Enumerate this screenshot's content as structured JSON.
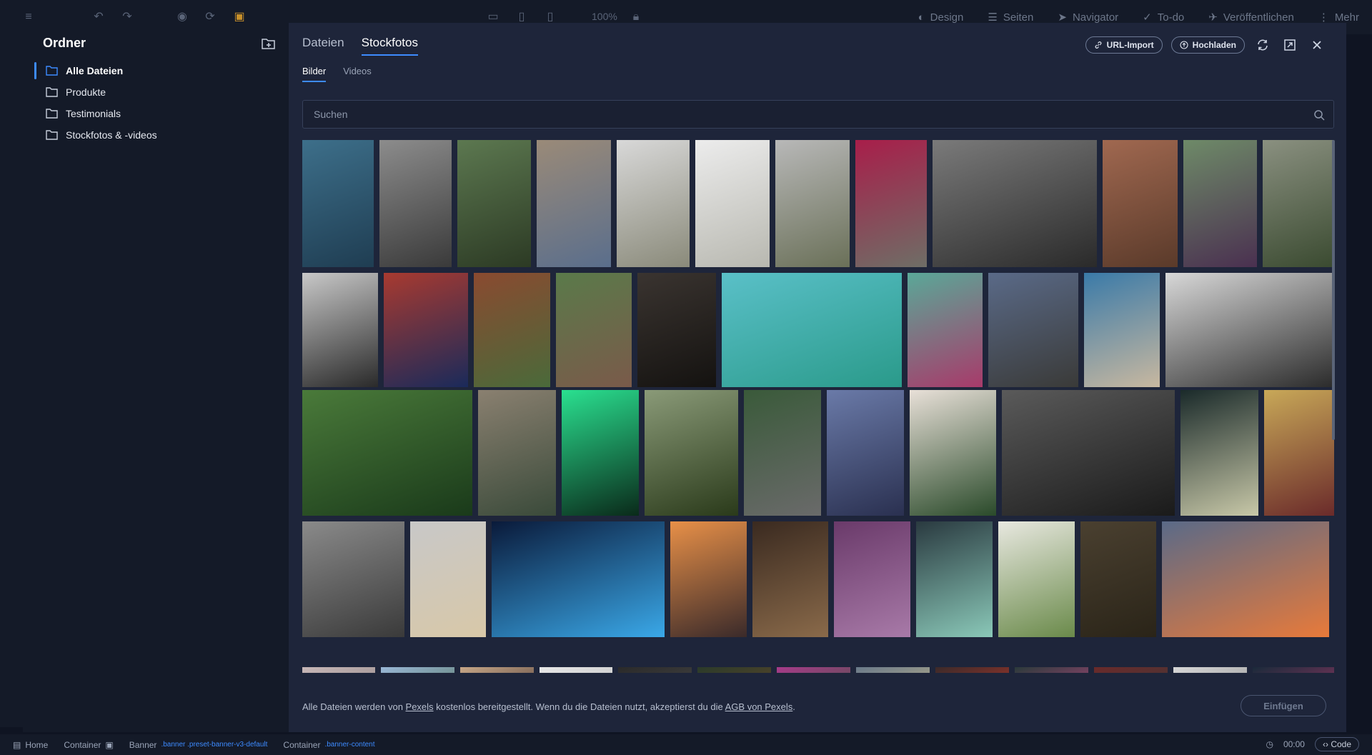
{
  "topbar": {
    "zoom": "100%",
    "items": [
      {
        "icon": "palette-icon",
        "label": "Design"
      },
      {
        "icon": "list-icon",
        "label": "Seiten"
      },
      {
        "icon": "navigator-icon",
        "label": "Navigator"
      },
      {
        "icon": "check-circle-icon",
        "label": "To-do"
      },
      {
        "icon": "rocket-icon",
        "label": "Veröffentlichen"
      },
      {
        "icon": "more-vertical-icon",
        "label": "Mehr"
      }
    ]
  },
  "folders": {
    "title": "Ordner",
    "items": [
      {
        "label": "Alle Dateien",
        "active": true
      },
      {
        "label": "Produkte",
        "active": false
      },
      {
        "label": "Testimonials",
        "active": false
      },
      {
        "label": "Stockfotos & -videos",
        "active": false
      }
    ]
  },
  "main_tabs": [
    {
      "label": "Dateien",
      "active": false
    },
    {
      "label": "Stockfotos",
      "active": true
    }
  ],
  "sub_tabs": [
    {
      "label": "Bilder",
      "active": true
    },
    {
      "label": "Videos",
      "active": false
    }
  ],
  "actions": {
    "url_import": "URL-Import",
    "upload": "Hochladen"
  },
  "search": {
    "placeholder": "Suchen",
    "value": ""
  },
  "footer": {
    "text_before": "Alle Dateien werden von ",
    "pexels_link": "Pexels",
    "text_middle": " kostenlos bereitgestellt. Wenn du die Dateien nutzt, akzeptierst du die ",
    "terms_link": "AGB von Pexels",
    "text_after": ".",
    "insert_button": "Einfügen"
  },
  "statusbar": {
    "crumbs": [
      {
        "label": "Home",
        "cls": ""
      },
      {
        "label": "Container",
        "cls": ""
      },
      {
        "label": "Banner",
        "cls": ".banner .preset-banner-v3-default"
      },
      {
        "label": "Container",
        "cls": ".banner-content"
      }
    ],
    "time": "00:00",
    "code": "Code"
  },
  "photos": [
    {
      "row": 0,
      "colors": [
        "#3d6f8a",
        "#1f3d52"
      ]
    },
    {
      "row": 0,
      "colors": [
        "#8c8c8c",
        "#3a3a3a"
      ]
    },
    {
      "row": 0,
      "colors": [
        "#5c7850",
        "#2c3a24"
      ]
    },
    {
      "row": 0,
      "colors": [
        "#9a8a78",
        "#5a6e8c"
      ]
    },
    {
      "row": 0,
      "colors": [
        "#d8d8d8",
        "#8a8a7a"
      ]
    },
    {
      "row": 0,
      "colors": [
        "#ececec",
        "#b8b8b0"
      ]
    },
    {
      "row": 0,
      "colors": [
        "#b8b8b8",
        "#6a7058"
      ]
    },
    {
      "row": 0,
      "colors": [
        "#a81e4a",
        "#6e6e66"
      ]
    },
    {
      "row": 0,
      "colors": [
        "#7a7a7a",
        "#2a2a2a"
      ]
    },
    {
      "row": 0,
      "colors": [
        "#a06850",
        "#5a3a2a"
      ]
    },
    {
      "row": 0,
      "colors": [
        "#6e8a68",
        "#4a3050"
      ]
    },
    {
      "row": 0,
      "colors": [
        "#8a9080",
        "#3a4a30"
      ]
    },
    {
      "row": 1,
      "colors": [
        "#c8c8c8",
        "#2a2a2a"
      ]
    },
    {
      "row": 1,
      "colors": [
        "#a83a30",
        "#1a2a5a"
      ]
    },
    {
      "row": 1,
      "colors": [
        "#8a4a30",
        "#4a6a3a"
      ]
    },
    {
      "row": 1,
      "colors": [
        "#5a7a4a",
        "#7a5a4a"
      ]
    },
    {
      "row": 1,
      "colors": [
        "#3a3430",
        "#141210"
      ]
    },
    {
      "row": 1,
      "colors": [
        "#5ac0c8",
        "#2a9a8a"
      ]
    },
    {
      "row": 1,
      "colors": [
        "#5aa898",
        "#a83a6a"
      ]
    },
    {
      "row": 1,
      "colors": [
        "#5a6a88",
        "#3a3a38"
      ]
    },
    {
      "row": 1,
      "colors": [
        "#3a7aa8",
        "#c8b8a0"
      ]
    },
    {
      "row": 1,
      "colors": [
        "#d8d8d8",
        "#2a2a2a"
      ]
    },
    {
      "row": 2,
      "colors": [
        "#4a7a3a",
        "#1a3a1a"
      ]
    },
    {
      "row": 2,
      "colors": [
        "#8a8070",
        "#3a4a3a"
      ]
    },
    {
      "row": 2,
      "colors": [
        "#2ae090",
        "#0a2a1a"
      ]
    },
    {
      "row": 2,
      "colors": [
        "#8a9a78",
        "#2a3a1a"
      ]
    },
    {
      "row": 2,
      "colors": [
        "#3a5a3a",
        "#6a6a6a"
      ]
    },
    {
      "row": 2,
      "colors": [
        "#6a7aa8",
        "#2a3050"
      ]
    },
    {
      "row": 2,
      "colors": [
        "#e8e0d8",
        "#2a4a2a"
      ]
    },
    {
      "row": 2,
      "colors": [
        "#5a5a5a",
        "#1a1a1a"
      ]
    },
    {
      "row": 2,
      "colors": [
        "#1a2a2a",
        "#c8c8a8"
      ]
    },
    {
      "row": 2,
      "colors": [
        "#c8a858",
        "#6a2a2a"
      ]
    },
    {
      "row": 3,
      "colors": [
        "#8a8a8a",
        "#3a3a3a"
      ]
    },
    {
      "row": 3,
      "colors": [
        "#c8c8c8",
        "#d8c8a8"
      ]
    },
    {
      "row": 3,
      "colors": [
        "#0a1a3a",
        "#3aa8e8"
      ]
    },
    {
      "row": 3,
      "colors": [
        "#e89048",
        "#3a2a2a"
      ]
    },
    {
      "row": 3,
      "colors": [
        "#3a2a20",
        "#8a6a4a"
      ]
    },
    {
      "row": 3,
      "colors": [
        "#6a3a6a",
        "#a87aa8"
      ]
    },
    {
      "row": 3,
      "colors": [
        "#2a3a40",
        "#8ac8b8"
      ]
    },
    {
      "row": 3,
      "colors": [
        "#e8e8e0",
        "#6a8a4a"
      ]
    },
    {
      "row": 3,
      "colors": [
        "#4a4030",
        "#2a2418"
      ]
    },
    {
      "row": 3,
      "colors": [
        "#5a6a88",
        "#e87a3a"
      ]
    },
    {
      "row": 4,
      "colors": [
        "#c8b8b8",
        "#8a8080"
      ]
    },
    {
      "row": 4,
      "colors": [
        "#9ab8d8",
        "#4a6a4a"
      ]
    },
    {
      "row": 4,
      "colors": [
        "#c8a888",
        "#3a2a2a"
      ]
    },
    {
      "row": 4,
      "colors": [
        "#e8e8e8",
        "#b8b8b8"
      ]
    },
    {
      "row": 4,
      "colors": [
        "#2a2a2a",
        "#4a4a4a"
      ]
    },
    {
      "row": 4,
      "colors": [
        "#2a3a2a",
        "#6a4a2a"
      ]
    },
    {
      "row": 4,
      "colors": [
        "#a83a8a",
        "#3a5a3a"
      ]
    },
    {
      "row": 4,
      "colors": [
        "#6a7a8a",
        "#c8b888"
      ]
    },
    {
      "row": 4,
      "colors": [
        "#3a2a2a",
        "#c83a2a"
      ]
    },
    {
      "row": 4,
      "colors": [
        "#2a3a3a",
        "#c84a8a"
      ]
    },
    {
      "row": 4,
      "colors": [
        "#6a2a2a",
        "#3a3a3a"
      ]
    },
    {
      "row": 4,
      "colors": [
        "#d8d8d8",
        "#8a8a8a"
      ]
    },
    {
      "row": 4,
      "colors": [
        "#1a2a3a",
        "#a83a6a"
      ]
    }
  ]
}
